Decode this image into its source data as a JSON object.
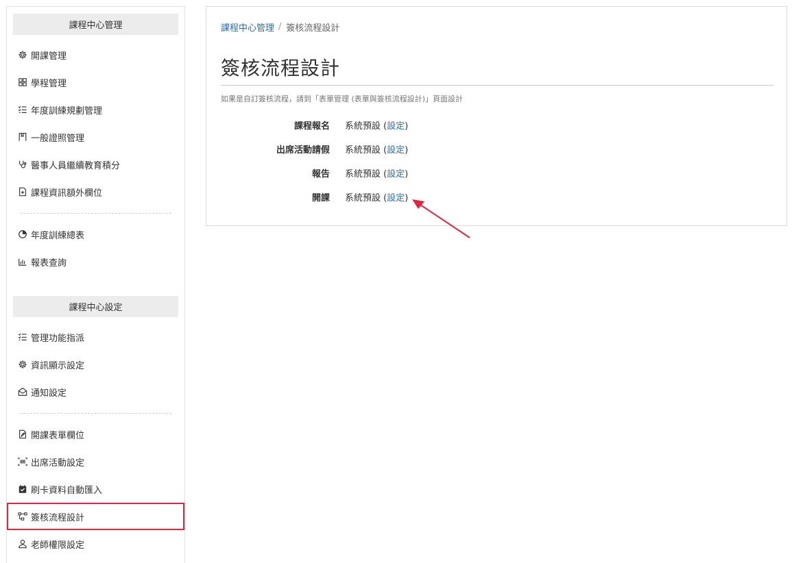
{
  "sidebar": {
    "sections": [
      {
        "header": "課程中心管理",
        "groups": [
          [
            "開課管理",
            "學程管理",
            "年度訓練規劃管理",
            "一般證照管理",
            "醫事人員繼續教育積分",
            "課程資訊額外欄位"
          ],
          [
            "年度訓練總表",
            "報表查詢"
          ]
        ]
      },
      {
        "header": "課程中心設定",
        "groups": [
          [
            "管理功能指派",
            "資訊顯示設定",
            "通知設定"
          ],
          [
            "開課表單欄位",
            "出席活動設定",
            "刷卡資料自動匯入",
            "簽核流程設計",
            "老師權限設定"
          ]
        ]
      }
    ],
    "icons": {
      "s0g0i0": "gear-icon",
      "s0g0i1": "grid-icon",
      "s0g0i2": "checklist-icon",
      "s0g0i3": "certificate-icon",
      "s0g0i4": "stethoscope-icon",
      "s0g0i5": "file-plus-icon",
      "s0g1i0": "pie-chart-icon",
      "s0g1i1": "bar-chart-icon",
      "s1g0i0": "checklist-icon",
      "s1g0i1": "gear-icon",
      "s1g0i2": "envelope-open-icon",
      "s1g1i0": "file-edit-icon",
      "s1g1i1": "barcode-icon",
      "s1g1i2": "calendar-check-icon",
      "s1g1i3": "flow-diagram-icon",
      "s1g1i4": "user-icon"
    },
    "active_item": "簽核流程設計",
    "highlight_color": "#e0263b"
  },
  "breadcrumb": {
    "parent": "課程中心管理",
    "separator": "/",
    "current": "簽核流程設計"
  },
  "page": {
    "title": "簽核流程設計",
    "note": "如果是自訂簽核流程，請到「表單管理 (表單與簽核流程設計)」頁面設計"
  },
  "settings": {
    "rows": [
      {
        "label": "課程報名",
        "value": "系統預設",
        "open_paren": "(",
        "link": "設定",
        "close_paren": ")"
      },
      {
        "label": "出席活動請假",
        "value": "系統預設",
        "open_paren": "(",
        "link": "設定",
        "close_paren": ")"
      },
      {
        "label": "報告",
        "value": "系統預設",
        "open_paren": "(",
        "link": "設定",
        "close_paren": ")"
      },
      {
        "label": "開課",
        "value": "系統預設",
        "open_paren": "(",
        "link": "設定",
        "close_paren": ")"
      }
    ]
  },
  "colors": {
    "link": "#2f6fa8",
    "annotation_arrow": "#e0263b",
    "section_header_bg": "#ececec"
  }
}
